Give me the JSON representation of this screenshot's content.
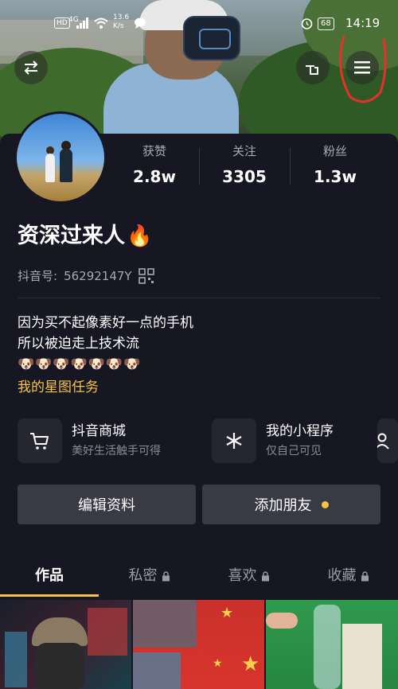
{
  "status_bar": {
    "hd": "HD",
    "network": "4G",
    "net_speed_value": "13.6",
    "net_speed_unit": "K/s",
    "battery": "68",
    "time": "14:19"
  },
  "header": {
    "left_icon": "switch-arrows-icon",
    "right_icons": [
      "hand-pointer-icon",
      "menu-icon"
    ]
  },
  "stats": [
    {
      "label": "获赞",
      "value": "2.8w"
    },
    {
      "label": "关注",
      "value": "3305"
    },
    {
      "label": "粉丝",
      "value": "1.3w"
    }
  ],
  "profile": {
    "nickname": "资深过来人",
    "nickname_emoji": "🔥",
    "uid_label": "抖音号:",
    "uid_value": "56292147Y",
    "bio_line1": "因为买不起像素好一点的手机",
    "bio_line2": "所以被迫走上技术流",
    "bio_emojis": "🐶🐶🐶🐶🐶🐶🐶",
    "task_link": "我的星图任务"
  },
  "services": [
    {
      "title": "抖音商城",
      "subtitle": "美好生活触手可得",
      "icon": "cart-icon"
    },
    {
      "title": "我的小程序",
      "subtitle": "仅自己可见",
      "icon": "asterisk-icon"
    }
  ],
  "actions": {
    "edit": "编辑资料",
    "add_friend": "添加朋友"
  },
  "tabs": [
    {
      "label": "作品",
      "locked": false
    },
    {
      "label": "私密",
      "locked": true
    },
    {
      "label": "喜欢",
      "locked": true
    },
    {
      "label": "收藏",
      "locked": true
    }
  ],
  "colors": {
    "background": "#161722",
    "accent": "#f6c445",
    "button": "#393a44",
    "annotation": "#e5302b"
  }
}
